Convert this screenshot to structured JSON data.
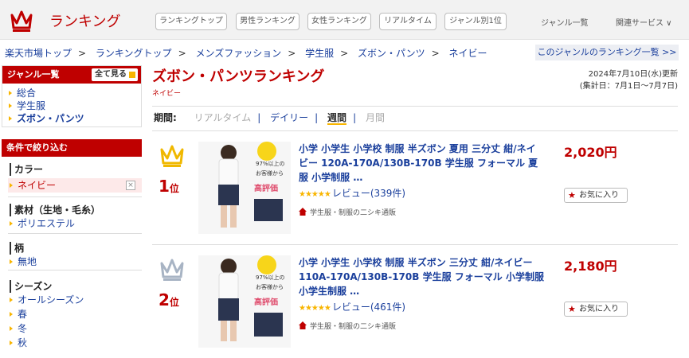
{
  "header": {
    "brand": "ランキング",
    "nav": [
      "ランキングトップ",
      "男性ランキング",
      "女性ランキング",
      "リアルタイム",
      "ジャンル別1位"
    ],
    "links": {
      "genre_list": "ジャンル一覧",
      "related": "関連サービス ∨"
    },
    "accent": "#bf0000"
  },
  "breadcrumb": [
    "楽天市場トップ",
    "ランキングトップ",
    "メンズファッション",
    "学生服",
    "ズボン・パンツ",
    "ネイビー"
  ],
  "genre_ranking_link": "このジャンルのランキング一覧 >>",
  "sidebar": {
    "genre_box": {
      "title": "ジャンル一覧",
      "all_label": "全て見る",
      "items": [
        "総合",
        "学生服",
        "ズボン・パンツ"
      ]
    },
    "filter_box": {
      "title": "条件で絞り込む",
      "color": {
        "title": "カラー",
        "selected": "ネイビー",
        "clear": "×"
      },
      "material": {
        "title": "素材（生地・毛糸）",
        "items": [
          "ポリエステル"
        ]
      },
      "pattern": {
        "title": "柄",
        "items": [
          "無地"
        ]
      },
      "season": {
        "title": "シーズン",
        "items": [
          "オールシーズン",
          "春",
          "冬",
          "秋"
        ]
      }
    }
  },
  "main": {
    "title": "ズボン・パンツランキング",
    "subtitle": "ネイビー",
    "updated": "2024年7月10日(水)更新",
    "period_range": "(集計日：7月1日〜7月7日)",
    "period": {
      "label": "期間:",
      "realtime": "リアルタイム",
      "daily": "デイリー",
      "weekly": "週間",
      "monthly": "月間"
    },
    "items": [
      {
        "rank": "1",
        "rank_suffix": "位",
        "name": "小学 小学生 小学校 制服 半ズボン 夏用 三分丈 紺/ネイビー 120A-170A/130B-170B 学生服 フォーマル 夏服 小学制服 …",
        "stars": "★★★★★",
        "review": "レビュー(339件)",
        "shop": "学生服・制服の二シキ通販",
        "price": "2,020円",
        "fav": "お気に入り",
        "crown_color": "#f0b800",
        "img_text_1": "97%以上の",
        "img_text_2": "お客様から",
        "img_text_3": "高評価"
      },
      {
        "rank": "2",
        "rank_suffix": "位",
        "name": "小学 小学生 小学校 制服 半ズボン 三分丈 紺/ネイビー 110A-170A/130B-170B 学生服 フォーマル 小学制服 小学生制服 …",
        "stars": "★★★★★",
        "review": "レビュー(461件)",
        "shop": "学生服・制服の二シキ通販",
        "price": "2,180円",
        "fav": "お気に入り",
        "crown_color": "#a8b4c4",
        "img_text_1": "97%以上の",
        "img_text_2": "お客様から",
        "img_text_3": "高評価"
      }
    ]
  }
}
